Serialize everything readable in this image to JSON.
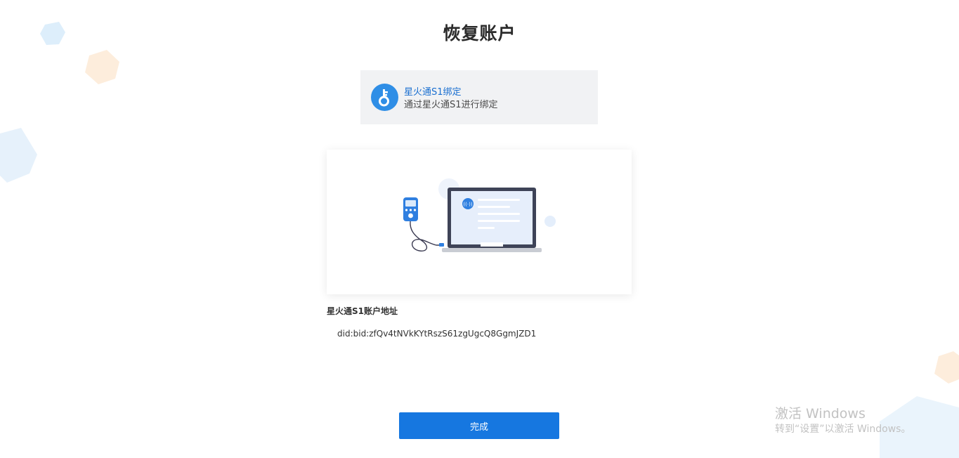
{
  "page": {
    "title": "恢复账户"
  },
  "method": {
    "icon": "usb-key-icon",
    "title": "星火通S1绑定",
    "description": "通过星火通S1进行绑定"
  },
  "illustration": {
    "icons": [
      "hardware-wallet-icon",
      "laptop-icon",
      "nfc-icon"
    ]
  },
  "address": {
    "label": "星火通S1账户地址",
    "value": "did:bid:zfQv4tNVkKYtRszS61zgUgcQ8GgmJZD1"
  },
  "actions": {
    "done_label": "完成"
  },
  "watermark": {
    "title": "激活 Windows",
    "subtitle": "转到“设置”以激活 Windows。"
  },
  "colors": {
    "accent": "#1677e0",
    "link_blue": "#1a6fd0",
    "card_bg": "#f1f2f4"
  }
}
